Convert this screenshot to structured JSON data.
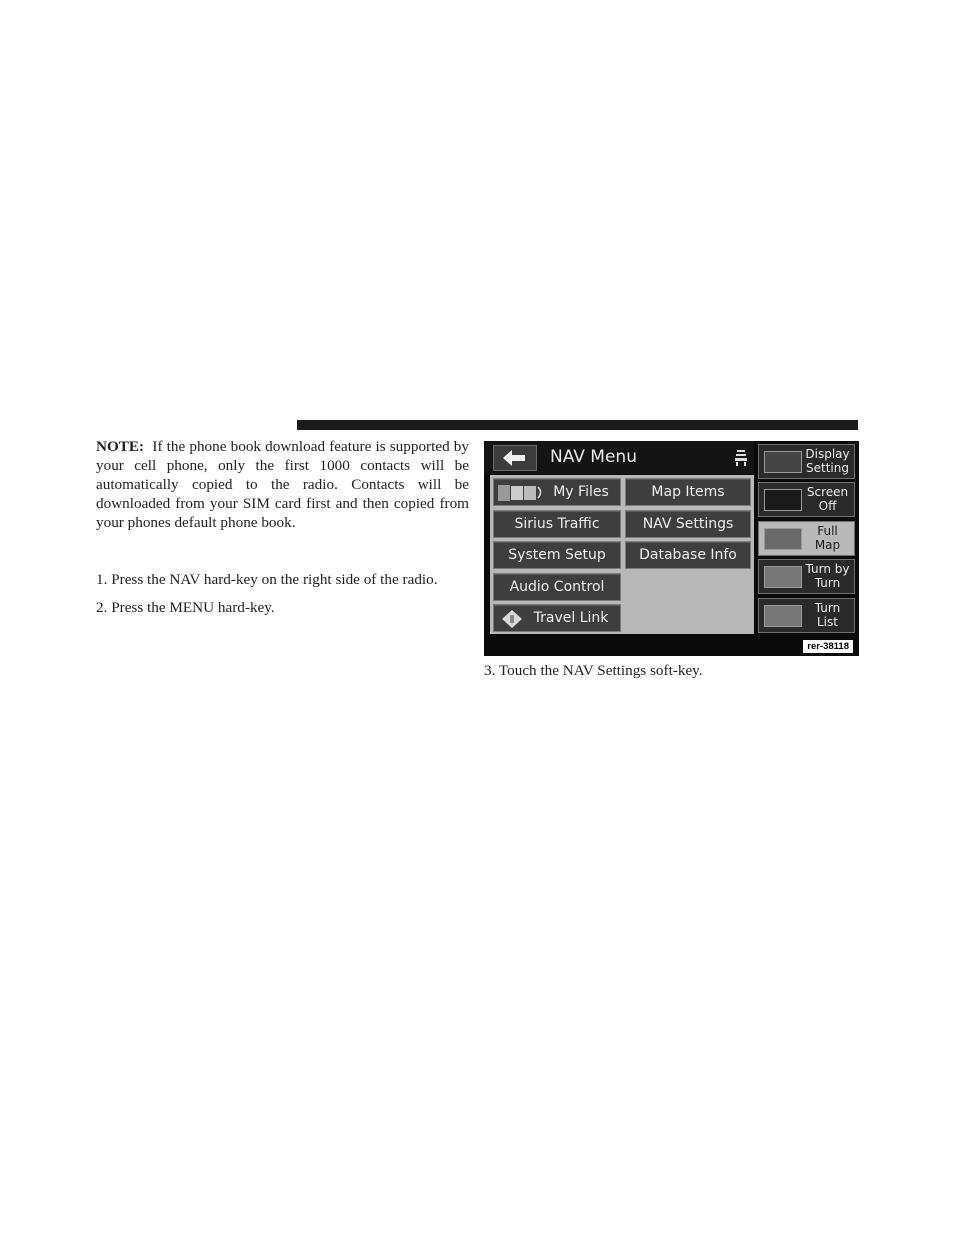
{
  "note": {
    "label": "NOTE:",
    "text": "If the phone book download feature is supported by your cell phone, only the first 1000 contacts will be automatically copied to the radio. Contacts will be downloaded from your SIM card first and then copied from your phones default phone book."
  },
  "steps": [
    "1.  Press the NAV hard-key on the right side of the radio.",
    "2.  Press the MENU hard-key.",
    "3.  Touch the NAV Settings soft-key."
  ],
  "screen": {
    "title": "NAV Menu",
    "back_icon": "arrow-left-icon",
    "buttons": [
      {
        "label": "My Files",
        "icon": "music-files-icon"
      },
      {
        "label": "Map Items"
      },
      {
        "label": "Sirius Traffic"
      },
      {
        "label": "NAV Settings"
      },
      {
        "label": "System Setup"
      },
      {
        "label": "Database Info"
      },
      {
        "label": "Audio Control"
      },
      {
        "label": "Travel Link",
        "icon": "travel-link-icon"
      }
    ],
    "side_buttons": [
      {
        "line1": "Display",
        "line2": "Setting"
      },
      {
        "line1": "Screen",
        "line2": "Off"
      },
      {
        "line1": "Full",
        "line2": "Map",
        "active": true
      },
      {
        "line1": "Turn by",
        "line2": "Turn"
      },
      {
        "line1": "Turn",
        "line2": "List"
      }
    ],
    "figure_code": "rer-38118"
  }
}
